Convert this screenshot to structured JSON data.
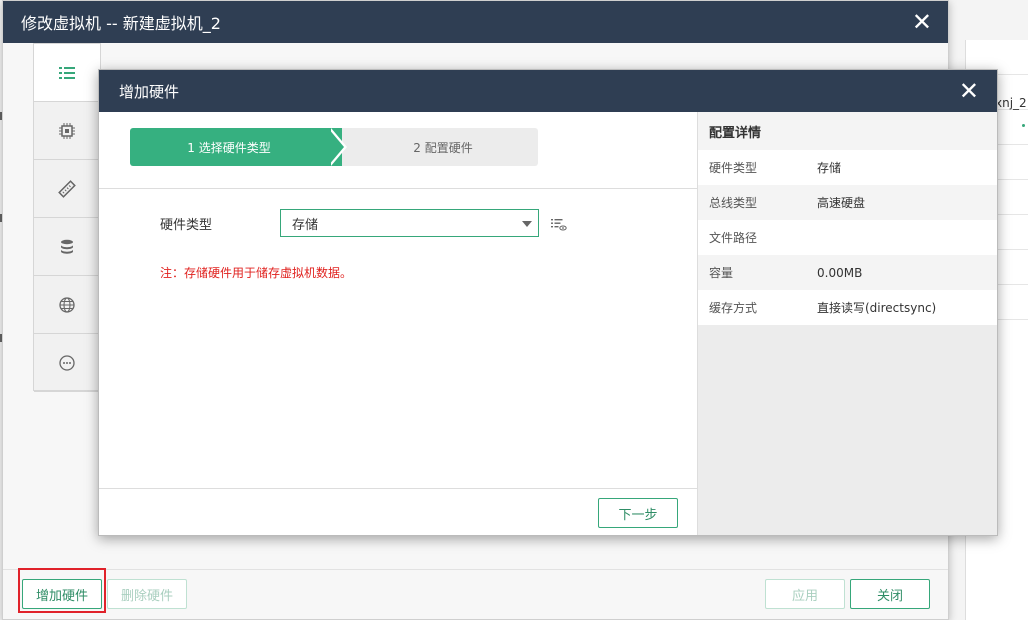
{
  "background": {
    "right_text": "xnj_2"
  },
  "outer_dialog": {
    "title": "修改虚拟机 -- 新建虚拟机_2",
    "close_icon": "close-icon",
    "side_nav": [
      {
        "icon": "list-icon",
        "active": true
      },
      {
        "icon": "cpu-icon",
        "active": false
      },
      {
        "icon": "memory-icon",
        "active": false
      },
      {
        "icon": "database-icon",
        "active": false
      },
      {
        "icon": "globe-icon",
        "active": false
      },
      {
        "icon": "more-icon",
        "active": false
      }
    ],
    "footer": {
      "add_hardware": "增加硬件",
      "remove_hardware": "删除硬件",
      "apply": "应用",
      "close": "关闭"
    }
  },
  "inner_dialog": {
    "title": "增加硬件",
    "steps": [
      {
        "label": "1 选择硬件类型",
        "active": true
      },
      {
        "label": "2 配置硬件",
        "active": false
      }
    ],
    "form": {
      "hardware_type_label": "硬件类型",
      "hardware_type_value": "存储"
    },
    "note": "注：存储硬件用于储存虚拟机数据。",
    "next_button": "下一步",
    "details": {
      "title": "配置详情",
      "rows": [
        {
          "key": "硬件类型",
          "value": "存储"
        },
        {
          "key": "总线类型",
          "value": "高速硬盘"
        },
        {
          "key": "文件路径",
          "value": ""
        },
        {
          "key": "容量",
          "value": "0.00MB"
        },
        {
          "key": "缓存方式",
          "value": "直接读写(directsync)"
        }
      ]
    }
  },
  "colors": {
    "header_bg": "#2f3e53",
    "accent_green": "#36b080",
    "note_red": "#e0221f",
    "highlight_red": "#e0222a"
  }
}
